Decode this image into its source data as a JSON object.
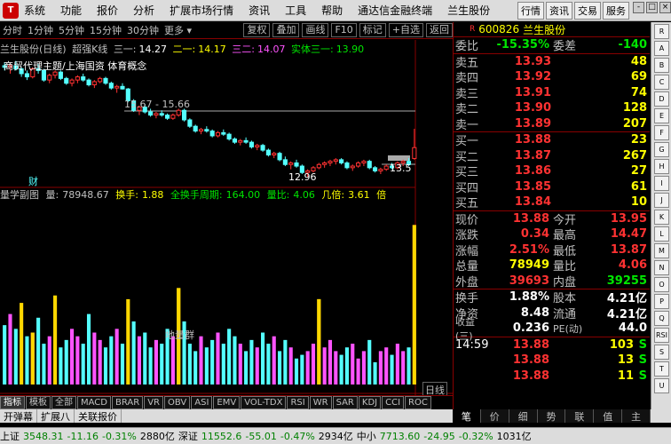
{
  "menu": {
    "items": [
      "系统",
      "功能",
      "报价",
      "分析",
      "扩展市场行情",
      "资讯",
      "工具",
      "帮助",
      "通达信金融终端",
      "兰生股份"
    ],
    "right_buttons": [
      "行情",
      "资讯",
      "交易",
      "服务"
    ],
    "window_controls": [
      "-",
      "□",
      "×"
    ]
  },
  "periods": {
    "items": [
      "分时",
      "1分钟",
      "5分钟",
      "15分钟",
      "30分钟",
      "更多 ▾"
    ],
    "tools": [
      "复权",
      "叠加",
      "画线",
      "F10",
      "标记",
      "+自选",
      "返回"
    ]
  },
  "main_info": {
    "name": "兰生股份(日线)",
    "style": "超强K线",
    "s1_label": "三一:",
    "s1_value": "14.27",
    "s2_label": "二一:",
    "s2_value": "14.17",
    "s3_label": "三二:",
    "s3_value": "14.07",
    "s4_label": "实体三一:",
    "s4_value": "13.90"
  },
  "overlays": {
    "concept": "商贸代理主题/上海国资 体育概念",
    "range": "15.67 - 15.66",
    "low": "12.96",
    "last": "13.5",
    "cai": "财",
    "dijiang": "地量群"
  },
  "sub_info": {
    "name": "量学副图",
    "vol_label": "量:",
    "vol_value": "78948.67",
    "turn_label": "换手:",
    "turn_value": "1.88",
    "full_label": "全换手周期:",
    "full_value": "164.00",
    "ratio_label": "量比:",
    "ratio_value": "4.06",
    "times_label": "几倍:",
    "times_value": "3.61",
    "times2_label": "倍"
  },
  "quote": {
    "code": "600826",
    "name": "兰生股份",
    "wb_label": "委比",
    "wb_value": "-15.35%",
    "wc_label": "委差",
    "wc_value": "-140",
    "sells": [
      {
        "label": "卖五",
        "price": "13.93",
        "vol": "48"
      },
      {
        "label": "卖四",
        "price": "13.92",
        "vol": "69"
      },
      {
        "label": "卖三",
        "price": "13.91",
        "vol": "74"
      },
      {
        "label": "卖二",
        "price": "13.90",
        "vol": "128"
      },
      {
        "label": "卖一",
        "price": "13.89",
        "vol": "207"
      }
    ],
    "buys": [
      {
        "label": "买一",
        "price": "13.88",
        "vol": "23"
      },
      {
        "label": "买二",
        "price": "13.87",
        "vol": "267"
      },
      {
        "label": "买三",
        "price": "13.86",
        "vol": "27"
      },
      {
        "label": "买四",
        "price": "13.85",
        "vol": "61"
      },
      {
        "label": "买五",
        "price": "13.84",
        "vol": "10"
      }
    ],
    "stats": [
      {
        "a": "现价",
        "b": "13.88",
        "c": "今开",
        "d": "13.95"
      },
      {
        "a": "涨跌",
        "b": "0.34",
        "c": "最高",
        "d": "14.47"
      },
      {
        "a": "涨幅",
        "b": "2.51%",
        "c": "最低",
        "d": "13.87"
      },
      {
        "a": "总量",
        "b": "78949",
        "c": "量比",
        "d": "4.06"
      },
      {
        "a": "外盘",
        "b": "39693",
        "c": "内盘",
        "d": "39255"
      }
    ],
    "stats2": [
      {
        "a": "换手",
        "b": "1.88%",
        "c": "股本",
        "d": "4.21亿"
      },
      {
        "a": "净资",
        "b": "8.48",
        "c": "流通",
        "d": "4.21亿"
      },
      {
        "a": "收益(三)",
        "b": "0.236",
        "c": "PE(动)",
        "d": "44.0"
      }
    ],
    "ticks": [
      {
        "t": "14:59",
        "p": "13.88",
        "v": "103",
        "s": "S"
      },
      {
        "t": "",
        "p": "13.88",
        "v": "13",
        "s": "S"
      },
      {
        "t": "",
        "p": "13.88",
        "v": "11",
        "s": "S"
      }
    ]
  },
  "bottom_tabs": [
    "指标",
    "模板",
    "全部",
    "MACD",
    "BRAR",
    "VR",
    "OBV",
    "ASI",
    "EMV",
    "VOL-TDX",
    "RSI",
    "WR",
    "SAR",
    "KDJ",
    "CCI",
    "ROC"
  ],
  "period_label": "日线",
  "tabs2": [
    "开弹幕",
    "扩展八",
    "关联报价"
  ],
  "right_tabs": [
    "笔",
    "价",
    "细",
    "势",
    "联",
    "值",
    "主"
  ],
  "sidebar_icons": [
    "R",
    "A",
    "B",
    "C",
    "D",
    "E",
    "F",
    "G",
    "H",
    "I",
    "J",
    "K",
    "L",
    "M",
    "N",
    "O",
    "P",
    "Q",
    "RSI",
    "S",
    "T",
    "U"
  ],
  "status": {
    "sh_label": "上证",
    "sh_value": "3548.31",
    "sh_change": "-11.16",
    "sh_pct": "-0.31%",
    "sh_amount": "2880亿",
    "sz_label": "深证",
    "sz_value": "11552.6",
    "sz_change": "-55.01",
    "sz_pct": "-0.47%",
    "sz_amount": "2934亿",
    "zx_label": "中小",
    "zx_value": "7713.60",
    "zx_change": "-24.95",
    "zx_pct": "-0.32%",
    "zx_amount": "1031亿"
  },
  "chart_data": {
    "type": "candlestick",
    "candles": [
      [
        16.45,
        16.55,
        16.3,
        16.4
      ],
      [
        16.4,
        16.5,
        16.2,
        16.45
      ],
      [
        16.45,
        16.6,
        16.3,
        16.35
      ],
      [
        16.35,
        16.4,
        16.1,
        16.2
      ],
      [
        16.2,
        16.3,
        16.0,
        16.1
      ],
      [
        16.1,
        16.4,
        16.05,
        16.35
      ],
      [
        16.35,
        16.5,
        16.2,
        16.3
      ],
      [
        16.3,
        16.35,
        15.95,
        16.0
      ],
      [
        16.0,
        16.2,
        15.9,
        16.15
      ],
      [
        16.15,
        16.3,
        16.05,
        16.25
      ],
      [
        16.25,
        16.3,
        16.0,
        16.05
      ],
      [
        16.05,
        16.1,
        15.85,
        15.9
      ],
      [
        15.9,
        16.05,
        15.8,
        16.0
      ],
      [
        16.0,
        16.15,
        15.9,
        16.1
      ],
      [
        16.1,
        16.2,
        15.95,
        16.0
      ],
      [
        16.0,
        16.05,
        15.8,
        15.85
      ],
      [
        15.85,
        16.0,
        15.75,
        15.95
      ],
      [
        15.95,
        16.1,
        15.9,
        16.05
      ],
      [
        16.05,
        16.1,
        15.85,
        15.9
      ],
      [
        15.9,
        15.95,
        15.7,
        15.75
      ],
      [
        15.75,
        15.85,
        15.6,
        15.8
      ],
      [
        15.8,
        15.9,
        15.7,
        15.72
      ],
      [
        15.72,
        15.75,
        15.3,
        15.35
      ],
      [
        15.35,
        15.4,
        15.0,
        15.05
      ],
      [
        15.05,
        15.2,
        14.9,
        15.15
      ],
      [
        15.15,
        15.25,
        14.95,
        15.0
      ],
      [
        15.0,
        15.1,
        14.85,
        14.9
      ],
      [
        14.9,
        15.0,
        14.8,
        14.95
      ],
      [
        14.95,
        15.05,
        14.85,
        14.9
      ],
      [
        14.9,
        14.95,
        14.75,
        14.8
      ],
      [
        14.8,
        14.95,
        14.75,
        14.9
      ],
      [
        14.9,
        15.1,
        14.85,
        15.05
      ],
      [
        15.05,
        15.1,
        14.7,
        14.75
      ],
      [
        14.75,
        14.8,
        14.5,
        14.55
      ],
      [
        14.55,
        14.6,
        14.35,
        14.4
      ],
      [
        14.4,
        14.5,
        14.3,
        14.45
      ],
      [
        14.45,
        14.55,
        14.35,
        14.4
      ],
      [
        14.4,
        14.45,
        14.2,
        14.25
      ],
      [
        14.25,
        14.4,
        14.2,
        14.35
      ],
      [
        14.35,
        14.45,
        14.25,
        14.3
      ],
      [
        14.3,
        14.35,
        14.1,
        14.15
      ],
      [
        14.15,
        14.2,
        14.0,
        14.05
      ],
      [
        14.05,
        14.15,
        13.95,
        14.1
      ],
      [
        14.1,
        14.2,
        14.0,
        14.05
      ],
      [
        14.05,
        14.1,
        13.85,
        13.9
      ],
      [
        13.9,
        14.0,
        13.8,
        13.95
      ],
      [
        13.95,
        14.0,
        13.75,
        13.8
      ],
      [
        13.8,
        13.85,
        13.6,
        13.65
      ],
      [
        13.65,
        13.75,
        13.55,
        13.7
      ],
      [
        13.7,
        13.75,
        13.45,
        13.5
      ],
      [
        13.5,
        13.6,
        13.3,
        13.35
      ],
      [
        13.35,
        13.45,
        13.2,
        13.4
      ],
      [
        13.4,
        13.5,
        13.25,
        13.3
      ],
      [
        13.3,
        13.35,
        13.05,
        13.1
      ],
      [
        13.1,
        13.2,
        12.96,
        13.15
      ],
      [
        13.15,
        13.3,
        13.1,
        13.25
      ],
      [
        13.25,
        13.4,
        13.2,
        13.35
      ],
      [
        13.35,
        13.45,
        13.25,
        13.4
      ],
      [
        13.4,
        13.5,
        13.3,
        13.45
      ],
      [
        13.45,
        13.55,
        13.35,
        13.5
      ],
      [
        13.5,
        13.55,
        13.35,
        13.4
      ],
      [
        13.4,
        13.45,
        13.2,
        13.25
      ],
      [
        13.25,
        13.35,
        13.15,
        13.3
      ],
      [
        13.3,
        13.45,
        13.25,
        13.4
      ],
      [
        13.4,
        13.5,
        13.3,
        13.45
      ],
      [
        13.45,
        13.5,
        13.2,
        13.25
      ],
      [
        13.25,
        13.3,
        13.1,
        13.15
      ],
      [
        13.15,
        13.25,
        13.05,
        13.2
      ],
      [
        13.2,
        13.35,
        13.15,
        13.3
      ],
      [
        13.3,
        13.4,
        13.2,
        13.25
      ],
      [
        13.25,
        13.45,
        13.2,
        13.4
      ],
      [
        13.4,
        13.5,
        13.3,
        13.45
      ],
      [
        13.45,
        13.55,
        13.3,
        13.35
      ],
      [
        13.54,
        14.47,
        13.5,
        13.88
      ]
    ],
    "volume": [
      32,
      38,
      30,
      44,
      26,
      28,
      36,
      22,
      26,
      48,
      20,
      24,
      30,
      26,
      22,
      38,
      28,
      24,
      20,
      26,
      30,
      22,
      46,
      34,
      26,
      28,
      20,
      24,
      22,
      30,
      26,
      52,
      34,
      22,
      18,
      26,
      20,
      24,
      28,
      22,
      30,
      26,
      22,
      18,
      24,
      20,
      28,
      22,
      26,
      18,
      24,
      20,
      14,
      16,
      18,
      22,
      46,
      20,
      24,
      18,
      16,
      20,
      22,
      14,
      18,
      24,
      12,
      18,
      20,
      16,
      22,
      18,
      20,
      86
    ]
  }
}
